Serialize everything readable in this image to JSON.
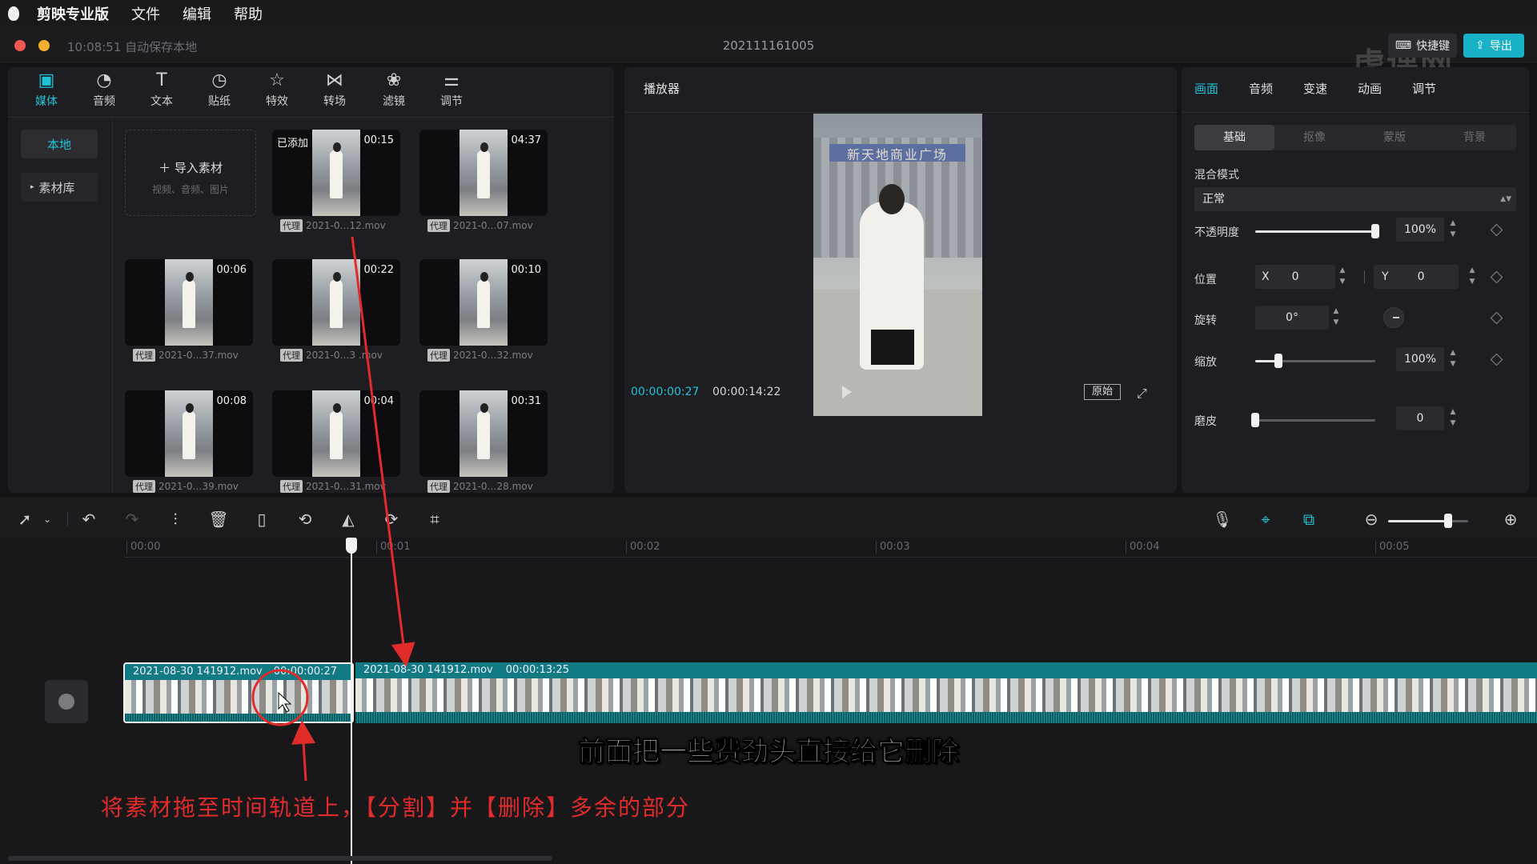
{
  "menubar": {
    "app": "剪映专业版",
    "items": [
      "文件",
      "编辑",
      "帮助"
    ]
  },
  "titlebar": {
    "autosave": "10:08:51 自动保存本地",
    "project": "202111161005",
    "shortcut": "快捷键",
    "export": "导出",
    "watermark": "虎课网"
  },
  "media_tabs": [
    {
      "label": "媒体",
      "icon": "media-icon"
    },
    {
      "label": "音频",
      "icon": "audio-icon"
    },
    {
      "label": "文本",
      "icon": "text-icon"
    },
    {
      "label": "贴纸",
      "icon": "sticker-icon"
    },
    {
      "label": "特效",
      "icon": "effects-icon"
    },
    {
      "label": "转场",
      "icon": "transition-icon"
    },
    {
      "label": "滤镜",
      "icon": "filter-icon"
    },
    {
      "label": "调节",
      "icon": "adjust-icon"
    }
  ],
  "media_sidebar": {
    "local": "本地",
    "library": "素材库"
  },
  "import": {
    "label": "导入素材",
    "hint": "视频、音频、图片"
  },
  "media_items": [
    {
      "duration": "00:15",
      "badge": "已添加",
      "proxy": "代理",
      "name": "2021-0…12.mov"
    },
    {
      "duration": "04:37",
      "badge": "",
      "proxy": "代理",
      "name": "2021-0…07.mov"
    },
    {
      "duration": "00:06",
      "badge": "",
      "proxy": "代理",
      "name": "2021-0…37.mov"
    },
    {
      "duration": "00:22",
      "badge": "",
      "proxy": "代理",
      "name": "2021-0…3 .mov"
    },
    {
      "duration": "00:10",
      "badge": "",
      "proxy": "代理",
      "name": "2021-0…32.mov"
    },
    {
      "duration": "00:08",
      "badge": "",
      "proxy": "代理",
      "name": "2021-0…39.mov"
    },
    {
      "duration": "00:04",
      "badge": "",
      "proxy": "代理",
      "name": "2021-0…31.mov"
    },
    {
      "duration": "00:31",
      "badge": "",
      "proxy": "代理",
      "name": "2021-0…28.mov"
    }
  ],
  "player": {
    "title": "播放器",
    "current": "00:00:00:27",
    "total": "00:00:14:22",
    "original": "原始",
    "video_sign": "新天地商业广场"
  },
  "props": {
    "tabs": [
      "画面",
      "音频",
      "变速",
      "动画",
      "调节"
    ],
    "subtabs": [
      "基础",
      "抠像",
      "蒙版",
      "背景"
    ],
    "blend_label": "混合模式",
    "blend_value": "正常",
    "opacity_label": "不透明度",
    "opacity_value": "100%",
    "opacity_fraction": 1.0,
    "position_label": "位置",
    "x_label": "X",
    "x_value": "0",
    "y_label": "Y",
    "y_value": "0",
    "rotation_label": "旋转",
    "rotation_value": "0°",
    "scale_label": "缩放",
    "scale_value": "100%",
    "scale_fraction": 0.19,
    "smooth_label": "磨皮",
    "smooth_value": "0",
    "smooth_fraction": 0.0
  },
  "timeline": {
    "ticks": [
      "00:00",
      "00:01",
      "00:02",
      "00:03",
      "00:04",
      "00:05"
    ],
    "clip1": {
      "name": "2021-08-30 141912.mov",
      "duration": "00:00:00:27"
    },
    "clip2": {
      "name": "2021-08-30 141912.mov",
      "duration": "00:00:13:25"
    },
    "zoom_fraction": 0.75
  },
  "overlay": {
    "subtitle": "前面把一些费劲头直接给它删除",
    "note": "将素材拖至时间轨道上，【分割】并【删除】多余的部分"
  },
  "colors": {
    "accent": "#1ec3d6",
    "annotation": "#e22b2b",
    "clip": "#127a82"
  }
}
